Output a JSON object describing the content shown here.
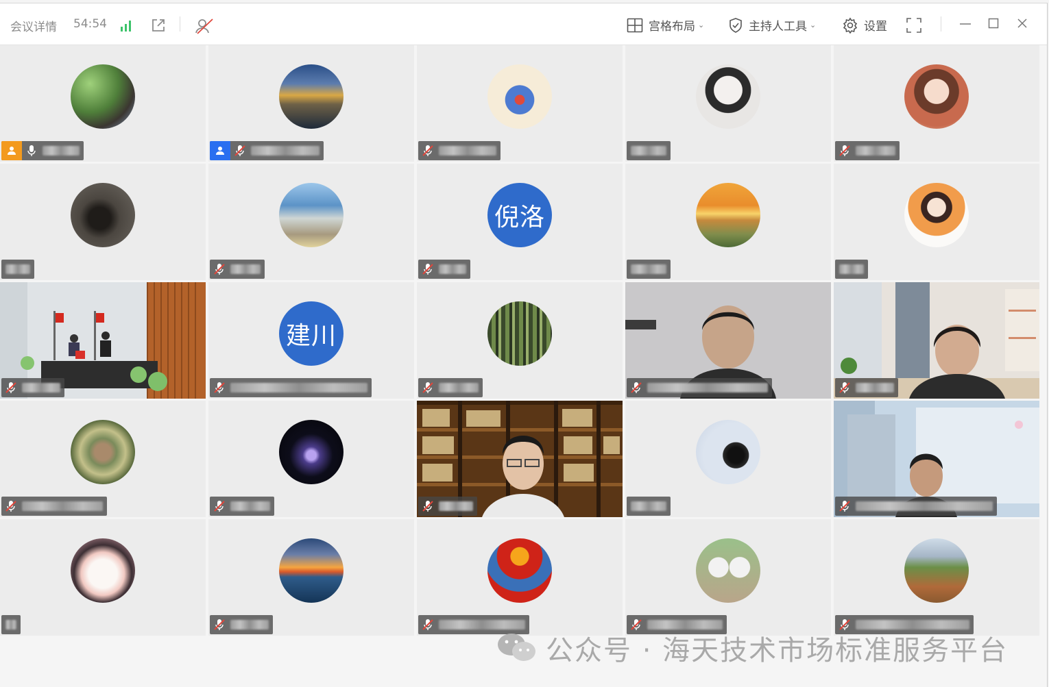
{
  "titlebar": {
    "meeting_details": "会议详情",
    "elapsed_time": "54:54",
    "layout_label": "宫格布局",
    "host_tools_label": "主持人工具",
    "settings_label": "设置"
  },
  "avatar_text": {
    "r1c2": "倪洛",
    "r2c1": "建川"
  },
  "watermark": "公众号 · 海天技术市场标准服务平台",
  "colors": {
    "host_badge_orange": "#f39a1e",
    "host_badge_blue": "#2a6ff0",
    "avatar_blue": "#2f6bcb",
    "mic_muted_red": "#e0463b",
    "signal_green": "#3cc36a"
  }
}
